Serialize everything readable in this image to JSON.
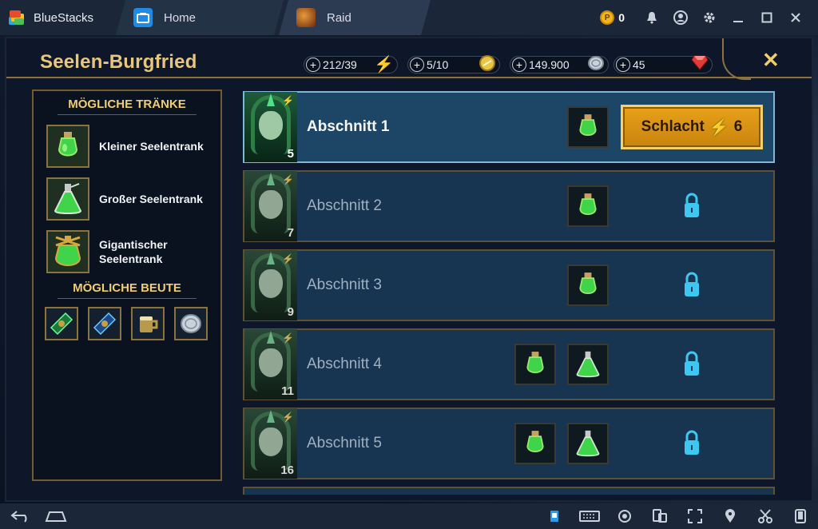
{
  "titlebar": {
    "app_name": "BlueStacks",
    "tabs": [
      {
        "label": "Home",
        "icon": "home-icon"
      },
      {
        "label": "Raid",
        "icon": "raid-game-icon"
      }
    ],
    "coin_count": "0",
    "coin_symbol": "P"
  },
  "game": {
    "title": "Seelen-Burgfried",
    "resources": [
      {
        "value": "212/39",
        "icon": "energy-bolt-icon"
      },
      {
        "value": "5/10",
        "icon": "arena-token-icon"
      },
      {
        "value": "149.900",
        "icon": "silver-icon"
      },
      {
        "value": "45",
        "icon": "gem-icon"
      }
    ],
    "close_symbol": "✕",
    "possible_potions_title": "MÖGLICHE TRÄNKE",
    "potions": [
      {
        "label": "Kleiner Seelentrank"
      },
      {
        "label": "Großer Seelentrank"
      },
      {
        "label": "Gigantischer Seelentrank"
      }
    ],
    "possible_loot_title": "MÖGLICHE BEUTE",
    "loot": [
      "green-shard-icon",
      "blue-shard-icon",
      "potion-mug-icon",
      "silver-coin-icon"
    ],
    "stages": [
      {
        "name": "Abschnitt 1",
        "level": "5",
        "drops": 1,
        "active": true
      },
      {
        "name": "Abschnitt 2",
        "level": "7",
        "drops": 1,
        "active": false
      },
      {
        "name": "Abschnitt 3",
        "level": "9",
        "drops": 1,
        "active": false
      },
      {
        "name": "Abschnitt 4",
        "level": "11",
        "drops": 2,
        "active": false
      },
      {
        "name": "Abschnitt 5",
        "level": "16",
        "drops": 2,
        "active": false
      }
    ],
    "battle_button": {
      "label": "Schlacht",
      "cost": "6"
    }
  },
  "colors": {
    "gold": "#f0cd6e",
    "stage_bg": "#173451",
    "active_border": "#7fb7d8",
    "battle_orange": "#e9a11a",
    "lock_cyan": "#3ec7f0"
  }
}
